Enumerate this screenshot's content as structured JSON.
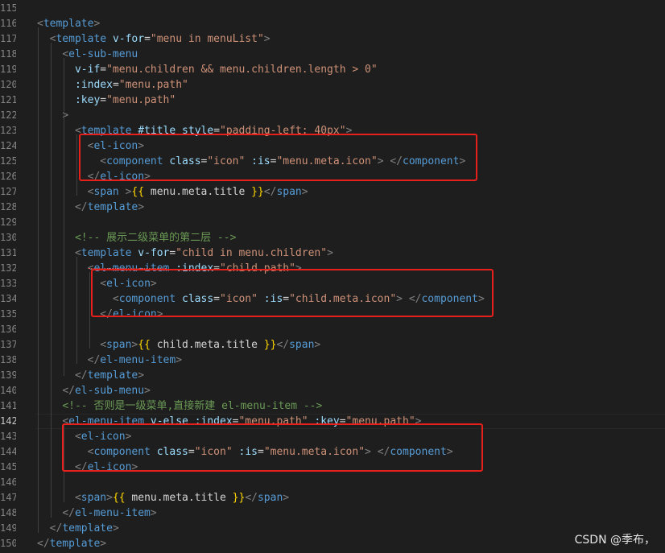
{
  "editor": {
    "lines": [
      {
        "n": "115",
        "segments": []
      },
      {
        "n": "116",
        "segments": [
          [
            "bracket",
            "<"
          ],
          [
            "tag",
            "template"
          ],
          [
            "bracket",
            ">"
          ]
        ]
      },
      {
        "n": "117",
        "segments": [
          [
            "plain",
            "  "
          ],
          [
            "bracket",
            "<"
          ],
          [
            "tag",
            "template"
          ],
          [
            "plain",
            " "
          ],
          [
            "attr",
            "v-for"
          ],
          [
            "plain",
            "="
          ],
          [
            "str",
            "\"menu in menuList\""
          ],
          [
            "bracket",
            ">"
          ]
        ]
      },
      {
        "n": "118",
        "segments": [
          [
            "plain",
            "    "
          ],
          [
            "bracket",
            "<"
          ],
          [
            "tag",
            "el-sub-menu"
          ]
        ]
      },
      {
        "n": "119",
        "segments": [
          [
            "plain",
            "      "
          ],
          [
            "attr",
            "v-if"
          ],
          [
            "plain",
            "="
          ],
          [
            "str",
            "\"menu.children && menu.children.length > 0\""
          ]
        ]
      },
      {
        "n": "120",
        "segments": [
          [
            "plain",
            "      "
          ],
          [
            "attr",
            ":index"
          ],
          [
            "plain",
            "="
          ],
          [
            "str",
            "\"menu.path\""
          ]
        ]
      },
      {
        "n": "121",
        "segments": [
          [
            "plain",
            "      "
          ],
          [
            "attr",
            ":key"
          ],
          [
            "plain",
            "="
          ],
          [
            "str",
            "\"menu.path\""
          ]
        ]
      },
      {
        "n": "122",
        "segments": [
          [
            "plain",
            "    "
          ],
          [
            "bracket",
            ">"
          ]
        ]
      },
      {
        "n": "123",
        "segments": [
          [
            "plain",
            "      "
          ],
          [
            "bracket",
            "<"
          ],
          [
            "tag",
            "template"
          ],
          [
            "plain",
            " "
          ],
          [
            "attr",
            "#title"
          ],
          [
            "plain",
            " "
          ],
          [
            "attr",
            "style"
          ],
          [
            "plain",
            "="
          ],
          [
            "str",
            "\"padding-left: 40px\""
          ],
          [
            "bracket",
            ">"
          ]
        ]
      },
      {
        "n": "124",
        "segments": [
          [
            "plain",
            "        "
          ],
          [
            "bracket",
            "<"
          ],
          [
            "tag",
            "el-icon"
          ],
          [
            "bracket",
            ">"
          ]
        ]
      },
      {
        "n": "125",
        "segments": [
          [
            "plain",
            "          "
          ],
          [
            "bracket",
            "<"
          ],
          [
            "tag",
            "component"
          ],
          [
            "plain",
            " "
          ],
          [
            "attr",
            "class"
          ],
          [
            "plain",
            "="
          ],
          [
            "str",
            "\"icon\""
          ],
          [
            "plain",
            " "
          ],
          [
            "attr",
            ":is"
          ],
          [
            "plain",
            "="
          ],
          [
            "str",
            "\"menu.meta.icon\""
          ],
          [
            "bracket",
            ">"
          ],
          [
            "plain",
            " "
          ],
          [
            "bracket",
            "</"
          ],
          [
            "tag",
            "component"
          ],
          [
            "bracket",
            ">"
          ]
        ]
      },
      {
        "n": "126",
        "segments": [
          [
            "plain",
            "        "
          ],
          [
            "bracket",
            "</"
          ],
          [
            "tag",
            "el-icon"
          ],
          [
            "bracket",
            ">"
          ]
        ]
      },
      {
        "n": "127",
        "segments": [
          [
            "plain",
            "        "
          ],
          [
            "bracket",
            "<"
          ],
          [
            "tag",
            "span"
          ],
          [
            "plain",
            " "
          ],
          [
            "bracket",
            ">"
          ],
          [
            "mustache",
            "{{"
          ],
          [
            "plain",
            " menu.meta.title "
          ],
          [
            "mustache",
            "}}"
          ],
          [
            "bracket",
            "</"
          ],
          [
            "tag",
            "span"
          ],
          [
            "bracket",
            ">"
          ]
        ]
      },
      {
        "n": "128",
        "segments": [
          [
            "plain",
            "      "
          ],
          [
            "bracket",
            "</"
          ],
          [
            "tag",
            "template"
          ],
          [
            "bracket",
            ">"
          ]
        ]
      },
      {
        "n": "129",
        "segments": []
      },
      {
        "n": "130",
        "segments": [
          [
            "plain",
            "      "
          ],
          [
            "comment",
            "<!-- 展示二级菜单的第二层 -->"
          ]
        ]
      },
      {
        "n": "131",
        "segments": [
          [
            "plain",
            "      "
          ],
          [
            "bracket",
            "<"
          ],
          [
            "tag",
            "template"
          ],
          [
            "plain",
            " "
          ],
          [
            "attr",
            "v-for"
          ],
          [
            "plain",
            "="
          ],
          [
            "str",
            "\"child in menu.children\""
          ],
          [
            "bracket",
            ">"
          ]
        ]
      },
      {
        "n": "132",
        "segments": [
          [
            "plain",
            "        "
          ],
          [
            "bracket",
            "<"
          ],
          [
            "tag",
            "el-menu-item"
          ],
          [
            "plain",
            " "
          ],
          [
            "attr",
            ":index"
          ],
          [
            "plain",
            "="
          ],
          [
            "str",
            "\"child.path\""
          ],
          [
            "bracket",
            ">"
          ]
        ]
      },
      {
        "n": "133",
        "segments": [
          [
            "plain",
            "          "
          ],
          [
            "bracket",
            "<"
          ],
          [
            "tag",
            "el-icon"
          ],
          [
            "bracket",
            ">"
          ]
        ]
      },
      {
        "n": "134",
        "segments": [
          [
            "plain",
            "            "
          ],
          [
            "bracket",
            "<"
          ],
          [
            "tag",
            "component"
          ],
          [
            "plain",
            " "
          ],
          [
            "attr",
            "class"
          ],
          [
            "plain",
            "="
          ],
          [
            "str",
            "\"icon\""
          ],
          [
            "plain",
            " "
          ],
          [
            "attr",
            ":is"
          ],
          [
            "plain",
            "="
          ],
          [
            "str",
            "\"child.meta.icon\""
          ],
          [
            "bracket",
            ">"
          ],
          [
            "plain",
            " "
          ],
          [
            "bracket",
            "</"
          ],
          [
            "tag",
            "component"
          ],
          [
            "bracket",
            ">"
          ]
        ]
      },
      {
        "n": "135",
        "segments": [
          [
            "plain",
            "          "
          ],
          [
            "bracket",
            "</"
          ],
          [
            "tag",
            "el-icon"
          ],
          [
            "bracket",
            ">"
          ]
        ]
      },
      {
        "n": "136",
        "segments": []
      },
      {
        "n": "137",
        "segments": [
          [
            "plain",
            "          "
          ],
          [
            "bracket",
            "<"
          ],
          [
            "tag",
            "span"
          ],
          [
            "bracket",
            ">"
          ],
          [
            "mustache",
            "{{"
          ],
          [
            "plain",
            " child.meta.title "
          ],
          [
            "mustache",
            "}}"
          ],
          [
            "bracket",
            "</"
          ],
          [
            "tag",
            "span"
          ],
          [
            "bracket",
            ">"
          ]
        ]
      },
      {
        "n": "138",
        "segments": [
          [
            "plain",
            "        "
          ],
          [
            "bracket",
            "</"
          ],
          [
            "tag",
            "el-menu-item"
          ],
          [
            "bracket",
            ">"
          ]
        ]
      },
      {
        "n": "139",
        "segments": [
          [
            "plain",
            "      "
          ],
          [
            "bracket",
            "</"
          ],
          [
            "tag",
            "template"
          ],
          [
            "bracket",
            ">"
          ]
        ]
      },
      {
        "n": "140",
        "segments": [
          [
            "plain",
            "    "
          ],
          [
            "bracket",
            "</"
          ],
          [
            "tag",
            "el-sub-menu"
          ],
          [
            "bracket",
            ">"
          ]
        ]
      },
      {
        "n": "141",
        "segments": [
          [
            "plain",
            "    "
          ],
          [
            "comment",
            "<!-- 否则是一级菜单,直接新建 el-menu-item -->"
          ]
        ]
      },
      {
        "n": "142",
        "segments": [
          [
            "plain",
            "    "
          ],
          [
            "bracket",
            "<"
          ],
          [
            "tag",
            "el-menu-item"
          ],
          [
            "plain",
            " "
          ],
          [
            "attr",
            "v-else"
          ],
          [
            "plain",
            " "
          ],
          [
            "attr",
            ":index"
          ],
          [
            "plain",
            "="
          ],
          [
            "str",
            "\"menu.path\""
          ],
          [
            "plain",
            " "
          ],
          [
            "attr",
            ":key"
          ],
          [
            "plain",
            "="
          ],
          [
            "str",
            "\"menu.path\""
          ],
          [
            "bracket",
            ">"
          ]
        ]
      },
      {
        "n": "143",
        "segments": [
          [
            "plain",
            "      "
          ],
          [
            "bracket",
            "<"
          ],
          [
            "tag",
            "el-icon"
          ],
          [
            "bracket",
            ">"
          ]
        ]
      },
      {
        "n": "144",
        "segments": [
          [
            "plain",
            "        "
          ],
          [
            "bracket",
            "<"
          ],
          [
            "tag",
            "component"
          ],
          [
            "plain",
            " "
          ],
          [
            "attr",
            "class"
          ],
          [
            "plain",
            "="
          ],
          [
            "str",
            "\"icon\""
          ],
          [
            "plain",
            " "
          ],
          [
            "attr",
            ":is"
          ],
          [
            "plain",
            "="
          ],
          [
            "str",
            "\"menu.meta.icon\""
          ],
          [
            "bracket",
            ">"
          ],
          [
            "plain",
            " "
          ],
          [
            "bracket",
            "</"
          ],
          [
            "tag",
            "component"
          ],
          [
            "bracket",
            ">"
          ]
        ]
      },
      {
        "n": "145",
        "segments": [
          [
            "plain",
            "      "
          ],
          [
            "bracket",
            "</"
          ],
          [
            "tag",
            "el-icon"
          ],
          [
            "bracket",
            ">"
          ]
        ]
      },
      {
        "n": "146",
        "segments": []
      },
      {
        "n": "147",
        "segments": [
          [
            "plain",
            "      "
          ],
          [
            "bracket",
            "<"
          ],
          [
            "tag",
            "span"
          ],
          [
            "bracket",
            ">"
          ],
          [
            "mustache",
            "{{"
          ],
          [
            "plain",
            " menu.meta.title "
          ],
          [
            "mustache",
            "}}"
          ],
          [
            "bracket",
            "</"
          ],
          [
            "tag",
            "span"
          ],
          [
            "bracket",
            ">"
          ]
        ]
      },
      {
        "n": "148",
        "segments": [
          [
            "plain",
            "    "
          ],
          [
            "bracket",
            "</"
          ],
          [
            "tag",
            "el-menu-item"
          ],
          [
            "bracket",
            ">"
          ]
        ]
      },
      {
        "n": "149",
        "segments": [
          [
            "plain",
            "  "
          ],
          [
            "bracket",
            "</"
          ],
          [
            "tag",
            "template"
          ],
          [
            "bracket",
            ">"
          ]
        ]
      },
      {
        "n": "150",
        "segments": [
          [
            "bracket",
            "</"
          ],
          [
            "tag",
            "template"
          ],
          [
            "bracket",
            ">"
          ]
        ]
      }
    ],
    "active_line": "142"
  },
  "watermark": "CSDN @季布，",
  "colors": {
    "background": "#1e1e1e",
    "tag": "#569cd6",
    "attribute": "#9cdcfe",
    "string": "#ce9178",
    "comment": "#6a9955",
    "mustache": "#ffd700",
    "highlight_box": "#e8201b"
  }
}
